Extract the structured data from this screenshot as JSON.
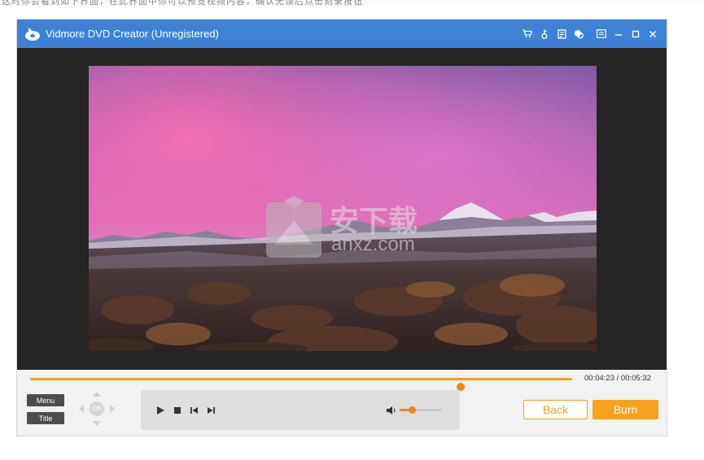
{
  "top_caption": "这时你会看到如下界面，在此界面中你可以预览视频内容，确认无误后点击刻录按钮",
  "app": {
    "title": "Vidmore DVD Creator (Unregistered)",
    "titlebar_icons": [
      "cart-icon",
      "key-icon",
      "register-icon",
      "feedback-icon",
      "menu-icon",
      "minimize-icon",
      "maximize-icon",
      "close-icon"
    ]
  },
  "player": {
    "current_time": "00:04:23",
    "time_separator": "/",
    "total_time": "00:05:32",
    "progress": 0.794,
    "volume": 0.28,
    "menu_label": "Menu",
    "title_label": "Title",
    "ok_label": "OK"
  },
  "watermark": {
    "chinese": "安下载",
    "domain": "anxz.com"
  },
  "actions": {
    "back_label": "Back",
    "burn_label": "Burn"
  },
  "colors": {
    "titlebar": "#3d82d6",
    "accent": "#f7a21c",
    "video_bg": "#252525"
  }
}
